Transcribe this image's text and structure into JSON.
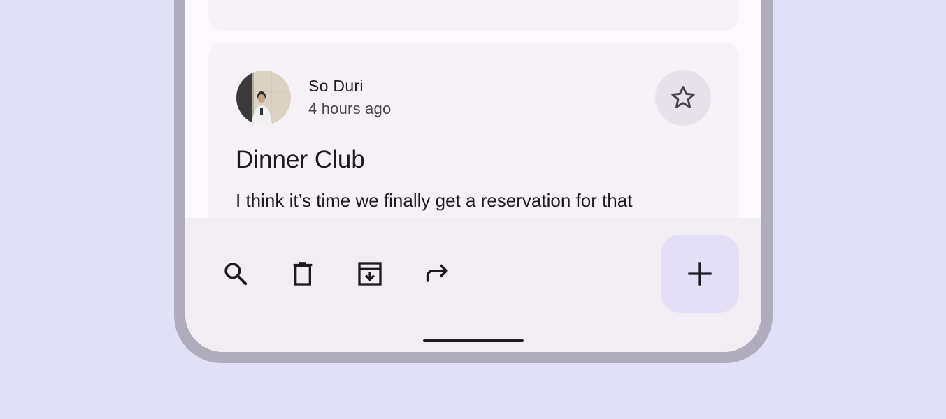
{
  "email": {
    "sender": "So Duri",
    "time": "4 hours ago",
    "subject": "Dinner Club",
    "preview": "I think it’s time we finally get a reservation for that",
    "starred": false
  },
  "bottom_bar": {
    "actions": [
      "search-icon",
      "delete-icon",
      "archive-icon",
      "forward-icon"
    ],
    "fab_icon": "add-icon"
  },
  "colors": {
    "background": "#e2e0f7",
    "card": "#f5f1f7",
    "fab": "#e2dff7",
    "text": "#1c1b1f"
  }
}
